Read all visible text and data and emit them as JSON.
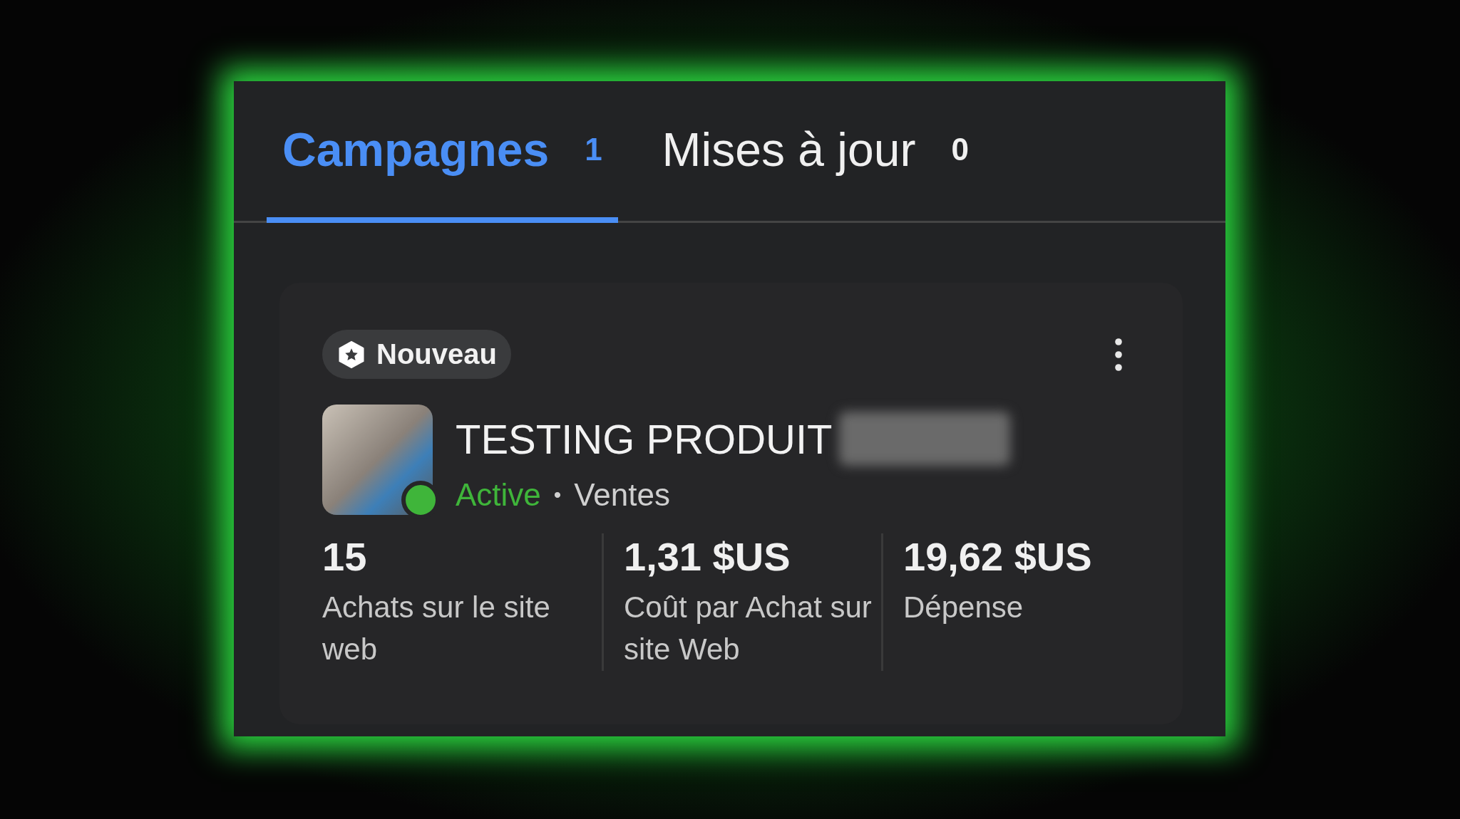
{
  "tabs": [
    {
      "label": "Campagnes",
      "count": "1",
      "selected": true
    },
    {
      "label": "Mises à jour",
      "count": "0",
      "selected": false
    }
  ],
  "campaign": {
    "badge": "Nouveau",
    "name": "TESTING PRODUIT",
    "active": true,
    "status": "Active",
    "separator": "•",
    "objective": "Ventes",
    "metrics": [
      {
        "value": "15",
        "label": "Achats sur le site web"
      },
      {
        "value": "1,31 $US",
        "label": "Coût par Achat sur site Web"
      },
      {
        "value": "19,62 $US",
        "label": "Dépense"
      }
    ]
  }
}
